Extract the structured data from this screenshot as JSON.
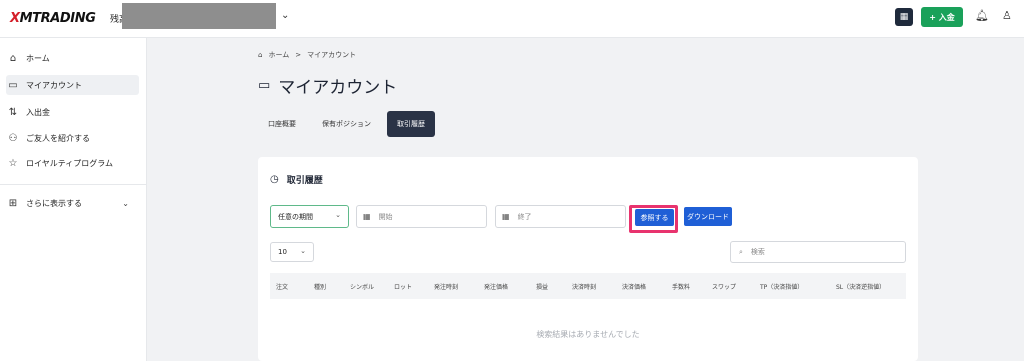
{
  "header": {
    "logo_prefix": "X",
    "logo_rest": "MTRADING",
    "balance_label": "残高",
    "chevron": "⌄",
    "deposit_label": "+ 入金",
    "icons": {
      "qr": "qr-icon",
      "bell": "bell-icon",
      "user": "user-icon"
    }
  },
  "sidebar": {
    "items": [
      {
        "label": "ホーム",
        "icon": "⌂",
        "icon_name": "home-icon"
      },
      {
        "label": "マイアカウント",
        "icon": "▭",
        "icon_name": "card-icon"
      },
      {
        "label": "入出金",
        "icon": "⇅",
        "icon_name": "transfer-icon"
      },
      {
        "label": "ご友人を紹介する",
        "icon": "⚇",
        "icon_name": "refer-icon"
      },
      {
        "label": "ロイヤルティプログラム",
        "icon": "☆",
        "icon_name": "star-icon"
      }
    ],
    "more": {
      "label": "さらに表示する",
      "icon": "⊞",
      "chevron": "⌄"
    }
  },
  "breadcrumb": {
    "home": "ホーム",
    "sep": ">",
    "current": "マイアカウント"
  },
  "page_title": "マイアカウント",
  "tabs": [
    {
      "label": "口座概要",
      "active": false
    },
    {
      "label": "保有ポジション",
      "active": false
    },
    {
      "label": "取引履歴",
      "active": true
    }
  ],
  "history": {
    "title": "取引履歴",
    "period_select": "任意の期間",
    "start_placeholder": "開始",
    "end_placeholder": "終了",
    "reference_button": "参照する",
    "download_button": "ダウンロード",
    "page_size": "10",
    "search_placeholder": "検索",
    "columns": [
      "注文",
      "種別",
      "シンボル",
      "ロット",
      "発注時刻",
      "発注価格",
      "損益",
      "決済時刻",
      "決済価格",
      "手数料",
      "スワップ",
      "TP（決済指値）",
      "SL（決済逆指値）"
    ],
    "empty_message": "検索結果はありませんでした"
  },
  "colors": {
    "accent_green": "#1aa15a",
    "primary_blue": "#1f5fd6",
    "highlight": "#e8336e",
    "dark": "#2a3346"
  }
}
